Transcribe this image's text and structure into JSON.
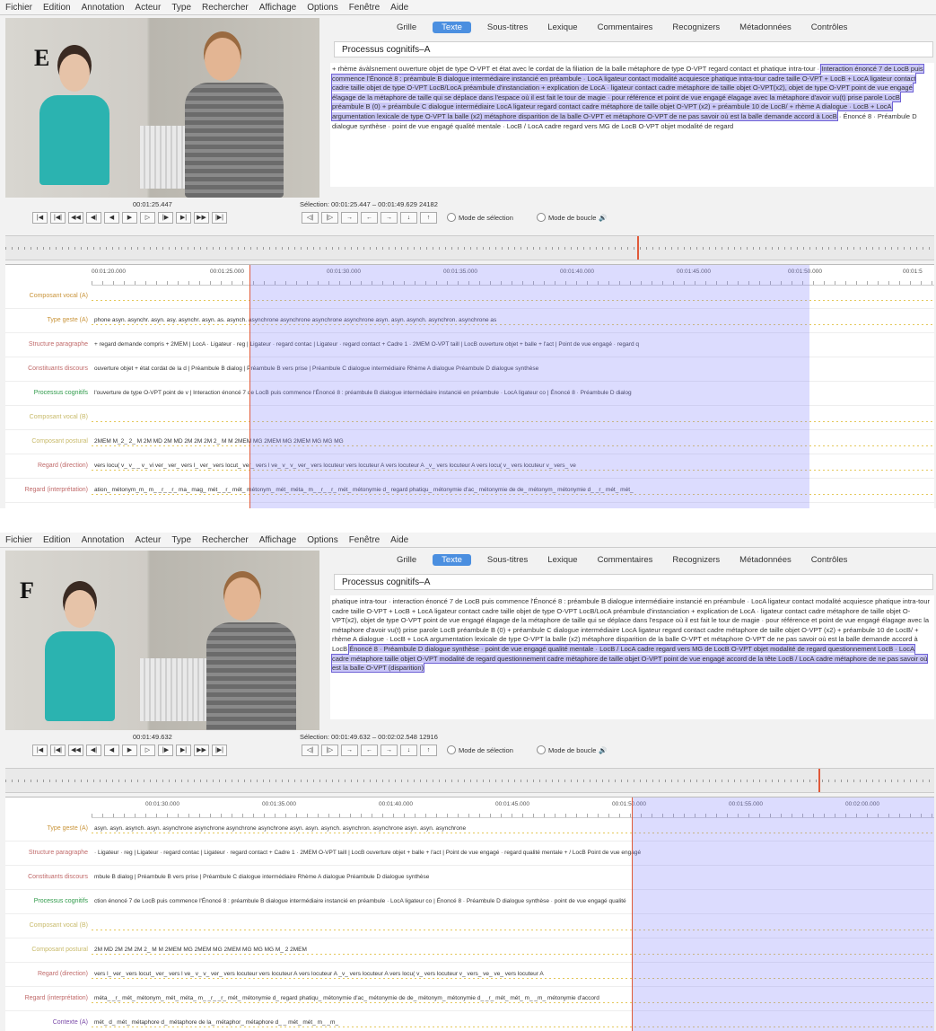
{
  "menu": [
    "Fichier",
    "Edition",
    "Annotation",
    "Acteur",
    "Type",
    "Rechercher",
    "Affichage",
    "Options",
    "Fenêtre",
    "Aide"
  ],
  "tabs": [
    {
      "label": "Grille",
      "active": false
    },
    {
      "label": "Texte",
      "active": true
    },
    {
      "label": "Sous-titres",
      "active": false
    },
    {
      "label": "Lexique",
      "active": false
    },
    {
      "label": "Commentaires",
      "active": false
    },
    {
      "label": "Recognizers",
      "active": false
    },
    {
      "label": "Métadonnées",
      "active": false
    },
    {
      "label": "Contrôles",
      "active": false
    }
  ],
  "controls": [
    "|◀",
    "|◀|",
    "◀◀",
    "◀|",
    "◀",
    "▶",
    "▷",
    "|▶",
    "▶|",
    "▶▶",
    "|▶|"
  ],
  "controls2": [
    "◁|",
    "|▷",
    "→",
    "←",
    "→",
    "↓",
    "↑"
  ],
  "mode_selection": "Mode de sélection",
  "mode_boucle": "Mode de boucle",
  "tier_selected": "Processus cognitifs–A",
  "panel_e": {
    "letter": "E",
    "time": "00:01:25.447",
    "selection": "Sélection: 00:01:25.447 – 00:01:49.629  24182",
    "text_before": "+ rhème ávàlsnement ouverture objet de type O-VPT et état avec le cordat de la filiation de la balle métaphore de type O-VPT regard contact et phatique intra-tour · ",
    "text_highlight": "Interaction énoncé 7 de LocB puis commence l'Énoncé 8 : préambule B dialogue intermédiaire instancié en préambule · LocA ligateur contact modalité acquiesce phatique intra-tour cadre taille O-VPT + LocB + LocA ligateur contact cadre taille objet de type O-VPT LocB/LocA préambule d'instanciation + explication de LocA · ligateur contact cadre métaphore de taille objet O-VPT(x2), objet de type O-VPT point de vue engagé élagage de la métaphore de taille qui se déplace dans l'espace où il est fait le tour de magie · pour référence et point de vue engagé élagage avec la métaphore d'avoir vu(t) prise parole LocB préambule B (0) + préambule C dialogue intermédiaire LocA ligateur regard contact cadre métaphore de taille objet O-VPT (x2) + préambule 10 de LocB/ + rhème A dialogue · LocB + LocA argumentation lexicale de type O-VPT la balle (x2) métaphore disparition de la balle O-VPT et métaphore O-VPT de ne pas savoir où est la balle demande accord à LocB",
    "text_after": " · Énoncé 8 · Préambule D dialogue synthèse · point de vue engagé qualité mentale · LocB / LocA cadre regard vers MG de LocB O-VPT objet modalité de regard",
    "ruler": [
      "00:01:20.000",
      "00:01:25.000",
      "00:01:30.000",
      "00:01:35.000",
      "00:01:40.000",
      "00:01:45.000",
      "00:01:50.000",
      "00:01:5"
    ],
    "tiers": [
      {
        "name": "Composant vocal (A)",
        "cls": "dim",
        "text": ""
      },
      {
        "name": "Type geste (A)",
        "cls": "",
        "text": "phone                                                                                asyn. asynchr. asyn. asy.  asynchr. asyn. as.  asynch. asynchrone    asynchrone       asynchrone     asynchrone asyn. asyn. asynch.   asynchron. asynchrone    as"
      },
      {
        "name": "Structure paragraphe",
        "cls": "red",
        "text": "+ regard demande compris + 2MEM  |  LocA · Ligateur · reg | Ligateur · regard contac | Ligateur · regard contact + Cadre 1 · 2MEM O-VPT taill | LocB ouverture objet + balle + l'act | Point de vue engagé · regard q"
      },
      {
        "name": "Constituants discours",
        "cls": "red",
        "text": "ouverture objet + état  cordat de la d  |  Préambule B dialog  |  Préambule B vers prise | Préambule C dialogue intermédiaire                       Rhème A dialogue                    Préambule D dialogue synthèse"
      },
      {
        "name": "Processus cognitifs",
        "cls": "green",
        "text": "l'ouverture de type O-VPT point de v | Interaction énoncé 7 de LocB puis commence l'Énoncé 8 : préambule B dialogue intermédiaire instancié en préambule · LocA ligateur co | Énoncé 8 · Préambule D dialog"
      },
      {
        "name": "Composant vocal (B)",
        "cls": "dim",
        "text": ""
      },
      {
        "name": "Composant postural",
        "cls": "dim",
        "text": "  2MEM   M_2_  2_  M 2M  MD 2M       MD 2M          2M 2M  2_  M M   2MEM         MG                2MEM                    MG                   2MEM        MG         MG  MG"
      },
      {
        "name": "Regard (direction)",
        "cls": "red",
        "text": "  vers locu( v_ v_ _ v_ vi ver_ ver_ vers l_ ver_ vers locut_ ver_ vers l ve_ v_ v_ ver_ vers locuteur vers locuteur A  vers locuteur A  _v_      vers locuteur A     vers locu( v_ vers locuteur  v_ vers_ ve"
      },
      {
        "name": "Regard (interprétation)",
        "cls": "red",
        "text": "ation_ métonym_m_ m_ _r_ _r_ ma_  mag_ mét_ _r_ mét_ métonym_ mét_ méta_ m_ _r_ _r_ mét_ métonymie d_ regard phatiqu_ métonymie d'ac_   métonymie de de_ métonym_   métonymie d_ _r_ mét_ mét_"
      }
    ]
  },
  "panel_f": {
    "letter": "F",
    "time": "00:01:49.632",
    "selection": "Sélection: 00:01:49.632 – 00:02:02.548  12916",
    "text_before": "phatique intra-tour · interaction énoncé 7 de LocB puis commence l'Énoncé 8 : préambule B dialogue intermédiaire instancié en préambule · LocA ligateur contact modalité acquiesce phatique intra-tour cadre taille O-VPT + LocB + LocA ligateur contact cadre taille objet de type O-VPT LocB/LocA préambule d'instanciation + explication de LocA · ligateur contact cadre métaphore de taille objet O-VPT(x2), objet de type O-VPT point de vue engagé élagage de la métaphore de taille qui se déplace dans l'espace où il est fait le tour de magie · pour référence et point de vue engagé élagage avec la métaphore d'avoir vu(t) prise parole LocB préambule B (0) + préambule C dialogue intermédiaire LocA ligateur regard contact cadre métaphore de taille objet O-VPT (x2) + préambule 10 de LocB/ + rhème A dialogue · LocB + LocA argumentation lexicale de type O-VPT la balle (x2) métaphore disparition de la balle O-VPT et métaphore O-VPT de ne pas savoir où est la balle demande accord à LocB ",
    "text_highlight": "Énoncé 8 · Préambule D dialogue synthèse · point de vue engagé qualité mentale · LocB / LocA cadre regard vers MG de LocB O-VPT objet modalité de regard questionnement LocB · LocA cadre métaphore taille objet O-VPT modalité de regard questionnement cadre métaphore de taille objet O-VPT point de vue engagé accord de la tête LocB / LocA cadre métaphore de ne pas savoir où est la balle O-VPT (disparition)",
    "text_after": "",
    "ruler": [
      "00:01:30.000",
      "00:01:35.000",
      "00:01:40.000",
      "00:01:45.000",
      "00:01:50.000",
      "00:01:55.000",
      "00:02:00.000"
    ],
    "tiers": [
      {
        "name": "Type geste (A)",
        "cls": "",
        "text": "asyn. asyn. asynch. asyn. asynchrone    asynchrone       asynchrone     asynchrone asyn. asyn. asynch.   asynchron. asynchrone  asyn. asyn. asynchrone"
      },
      {
        "name": "Structure paragraphe",
        "cls": "red",
        "text": "· Ligateur · reg | Ligateur · regard contac | Ligateur · regard contact + Cadre 1 · 2MEM O-VPT taill | LocB ouverture objet + balle + l'act | Point de vue engagé · regard qualité mentale + / LocB Point de vue engagé"
      },
      {
        "name": "Constituants discours",
        "cls": "red",
        "text": "mbule B dialog | Préambule B vers prise | Préambule C dialogue intermédiaire                       Rhème A dialogue                     Préambule D dialogue synthèse"
      },
      {
        "name": "Processus cognitifs",
        "cls": "green",
        "text": "ction énoncé 7 de LocB puis commence l'Énoncé 8 : préambule B dialogue intermédiaire instancié en préambule · LocA ligateur co | Énoncé 8 · Préambule D dialogue synthèse · point de vue engagé qualité"
      },
      {
        "name": "Composant vocal (B)",
        "cls": "dim",
        "text": ""
      },
      {
        "name": "Composant postural",
        "cls": "dim",
        "text": "2M     MD 2M          2M 2M  2_  M M   2MEM         MG                2MEM                    MG                   2MEM        MG         MG  MG  M_ 2  2MEM"
      },
      {
        "name": "Regard (direction)",
        "cls": "red",
        "text": "vers l_ ver_ vers locut_ ver_ vers l ve_ v_ v_ ver_ vers locuteur vers locuteur A  vers locuteur A  _v_      vers locuteur A     vers locu( v_ vers locuteur  v_ vers_ ve_ ve_ vers locuteur A"
      },
      {
        "name": "Regard (interprétation)",
        "cls": "red",
        "text": "méta_ _r_ mét_ métonym_ mét_ méta_ m_ _r_ _r_ mét_ métonymie d_ regard phatiqu_ métonymie d'ac_   métonymie de de_ métonym_   métonymie d_ _r_ mét_ mét_ m_ _m_ métonymie d'accord"
      },
      {
        "name": "Contexte (A)",
        "cls": "purple",
        "text": "          mét_                         d_ mét_ métaphore d_        métaphore de la_                     métaphor_  métaphore d_ _ mét_ mét_ m_ _m_"
      }
    ]
  }
}
